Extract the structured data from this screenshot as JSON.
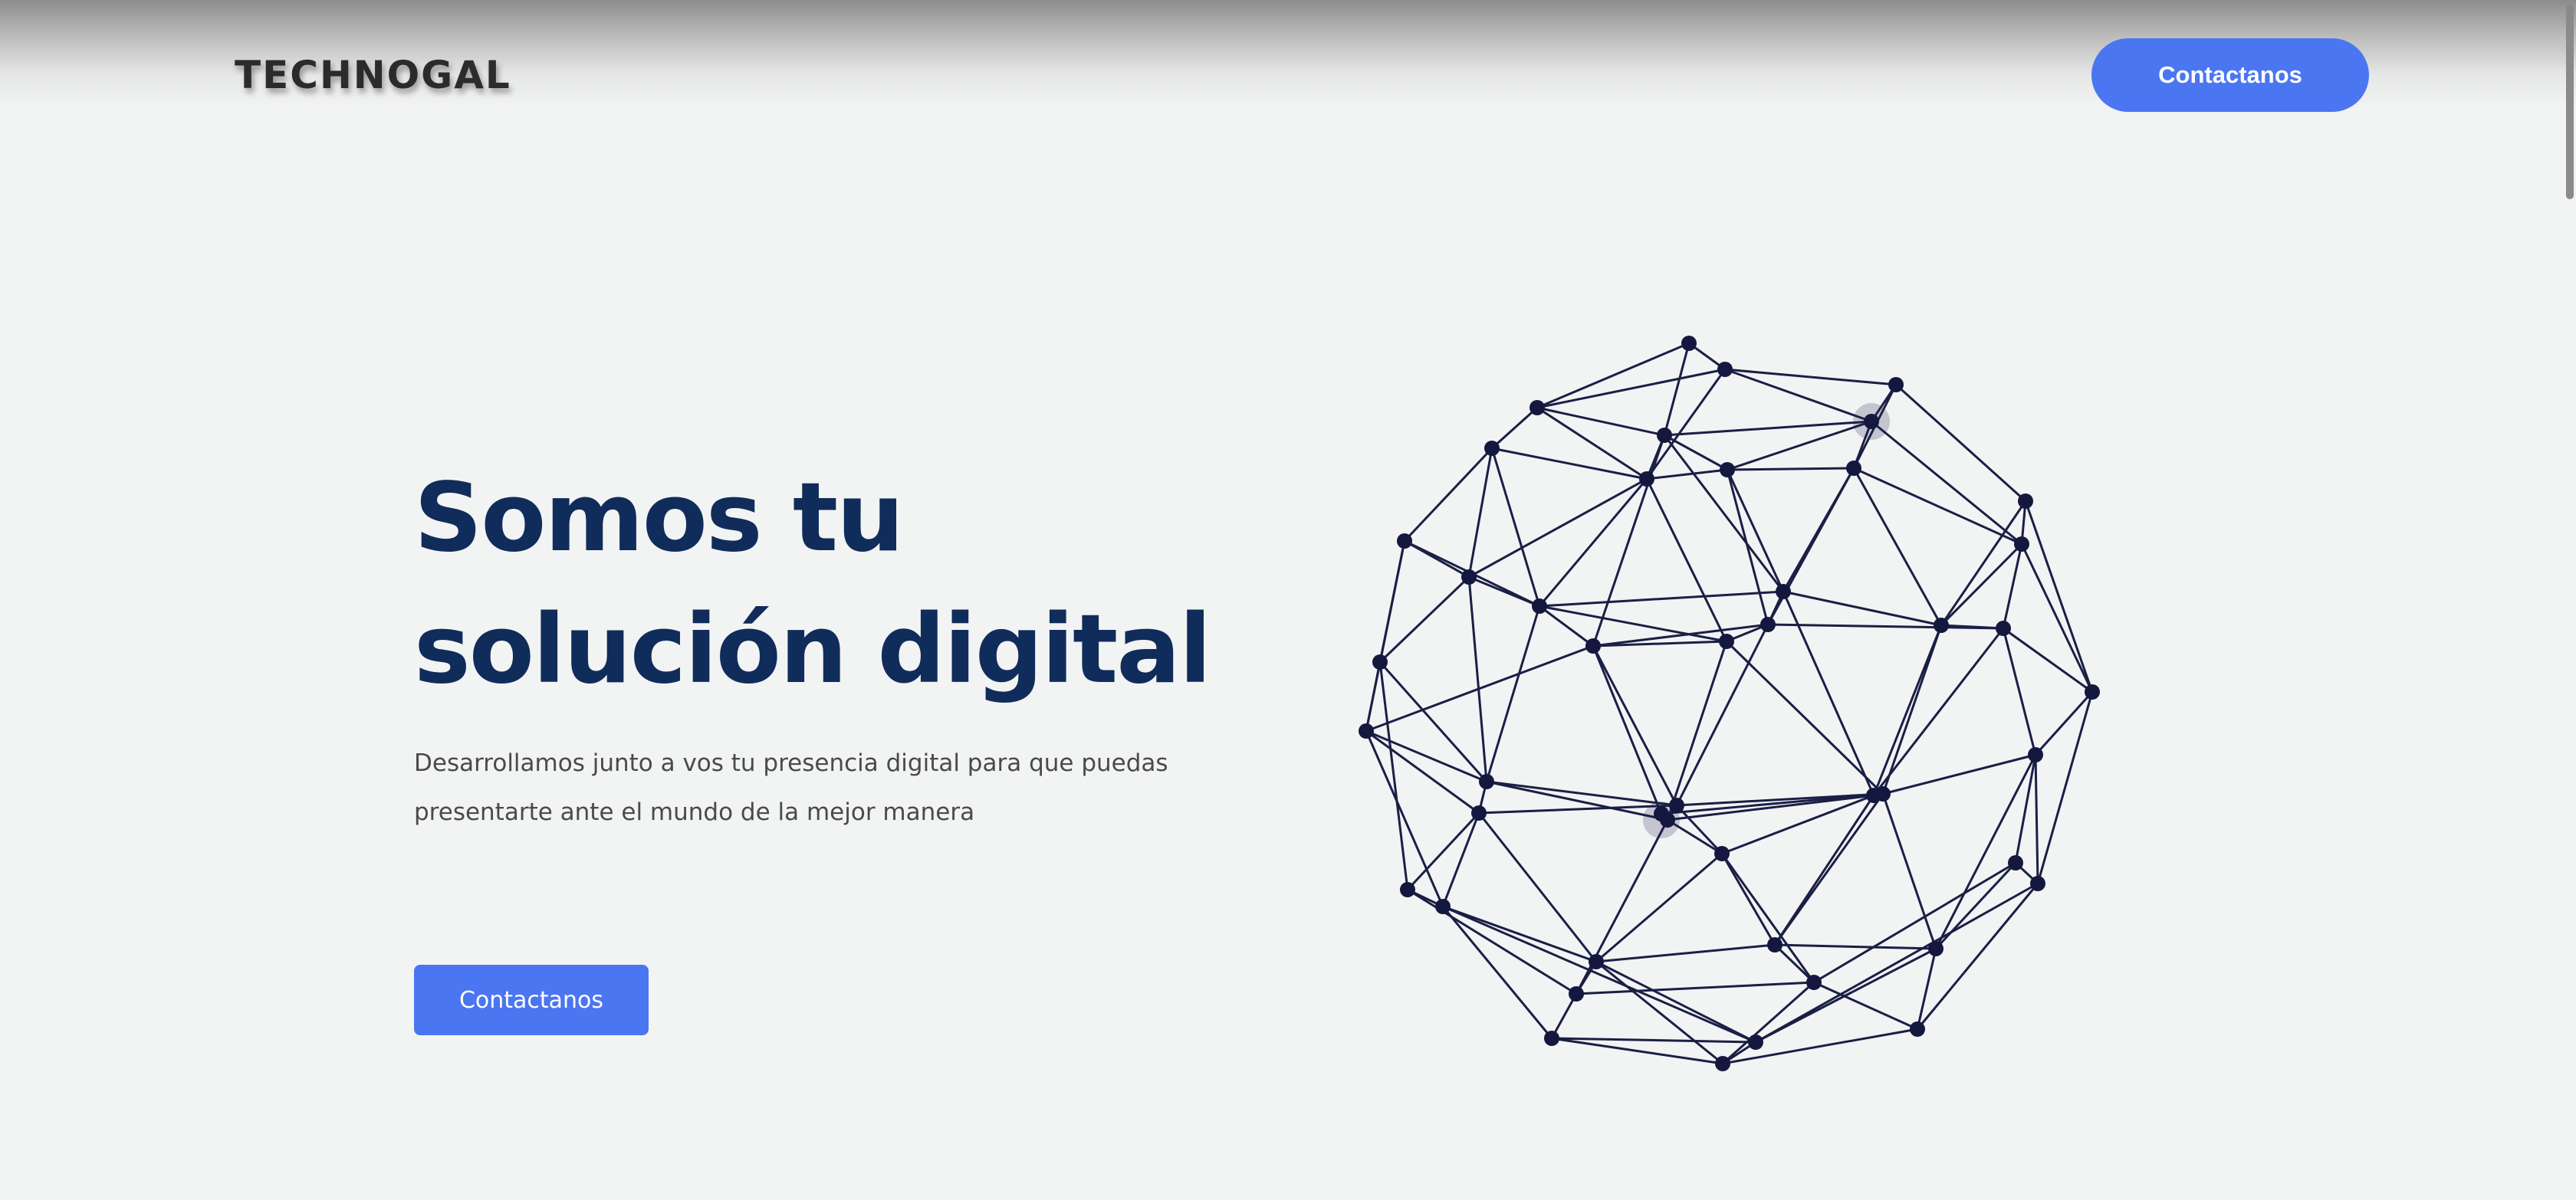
{
  "header": {
    "logo_text": "TECHNOGAL",
    "cta_label": "Contactanos"
  },
  "hero": {
    "title_line1": "Somos tu",
    "title_line2": "solución digital",
    "subtitle_line1": "Desarrollamos junto a vos tu presencia digital para que puedas",
    "subtitle_line2": "presentarte ante el mundo de la mejor manera",
    "cta_label": "Contactanos"
  },
  "globe": {
    "icon": "wireframe-globe-illustration",
    "line_color": "#1a1f45",
    "node_color": "#14183f"
  },
  "colors": {
    "accent": "#4b76f1",
    "title": "#102c5a",
    "background": "#f2f3f3",
    "body_text": "#4a4a4a"
  }
}
